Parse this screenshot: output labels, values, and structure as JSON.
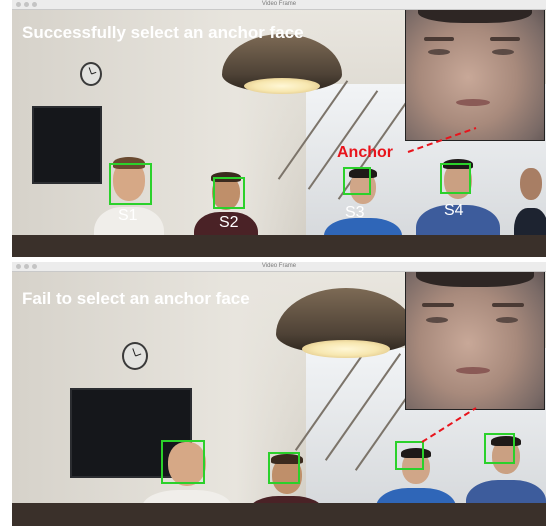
{
  "window_title": "Video Frame",
  "panels": {
    "top": {
      "headline": "Successfully select an anchor face",
      "anchor_label": "Anchor",
      "subjects": [
        "S1",
        "S2",
        "S3",
        "S4"
      ]
    },
    "bottom": {
      "headline": "Fail to select an anchor face"
    }
  },
  "colors": {
    "face_box": "#2bd12b",
    "anchor_line": "#e8141c",
    "headline_text": "#ffffff"
  }
}
